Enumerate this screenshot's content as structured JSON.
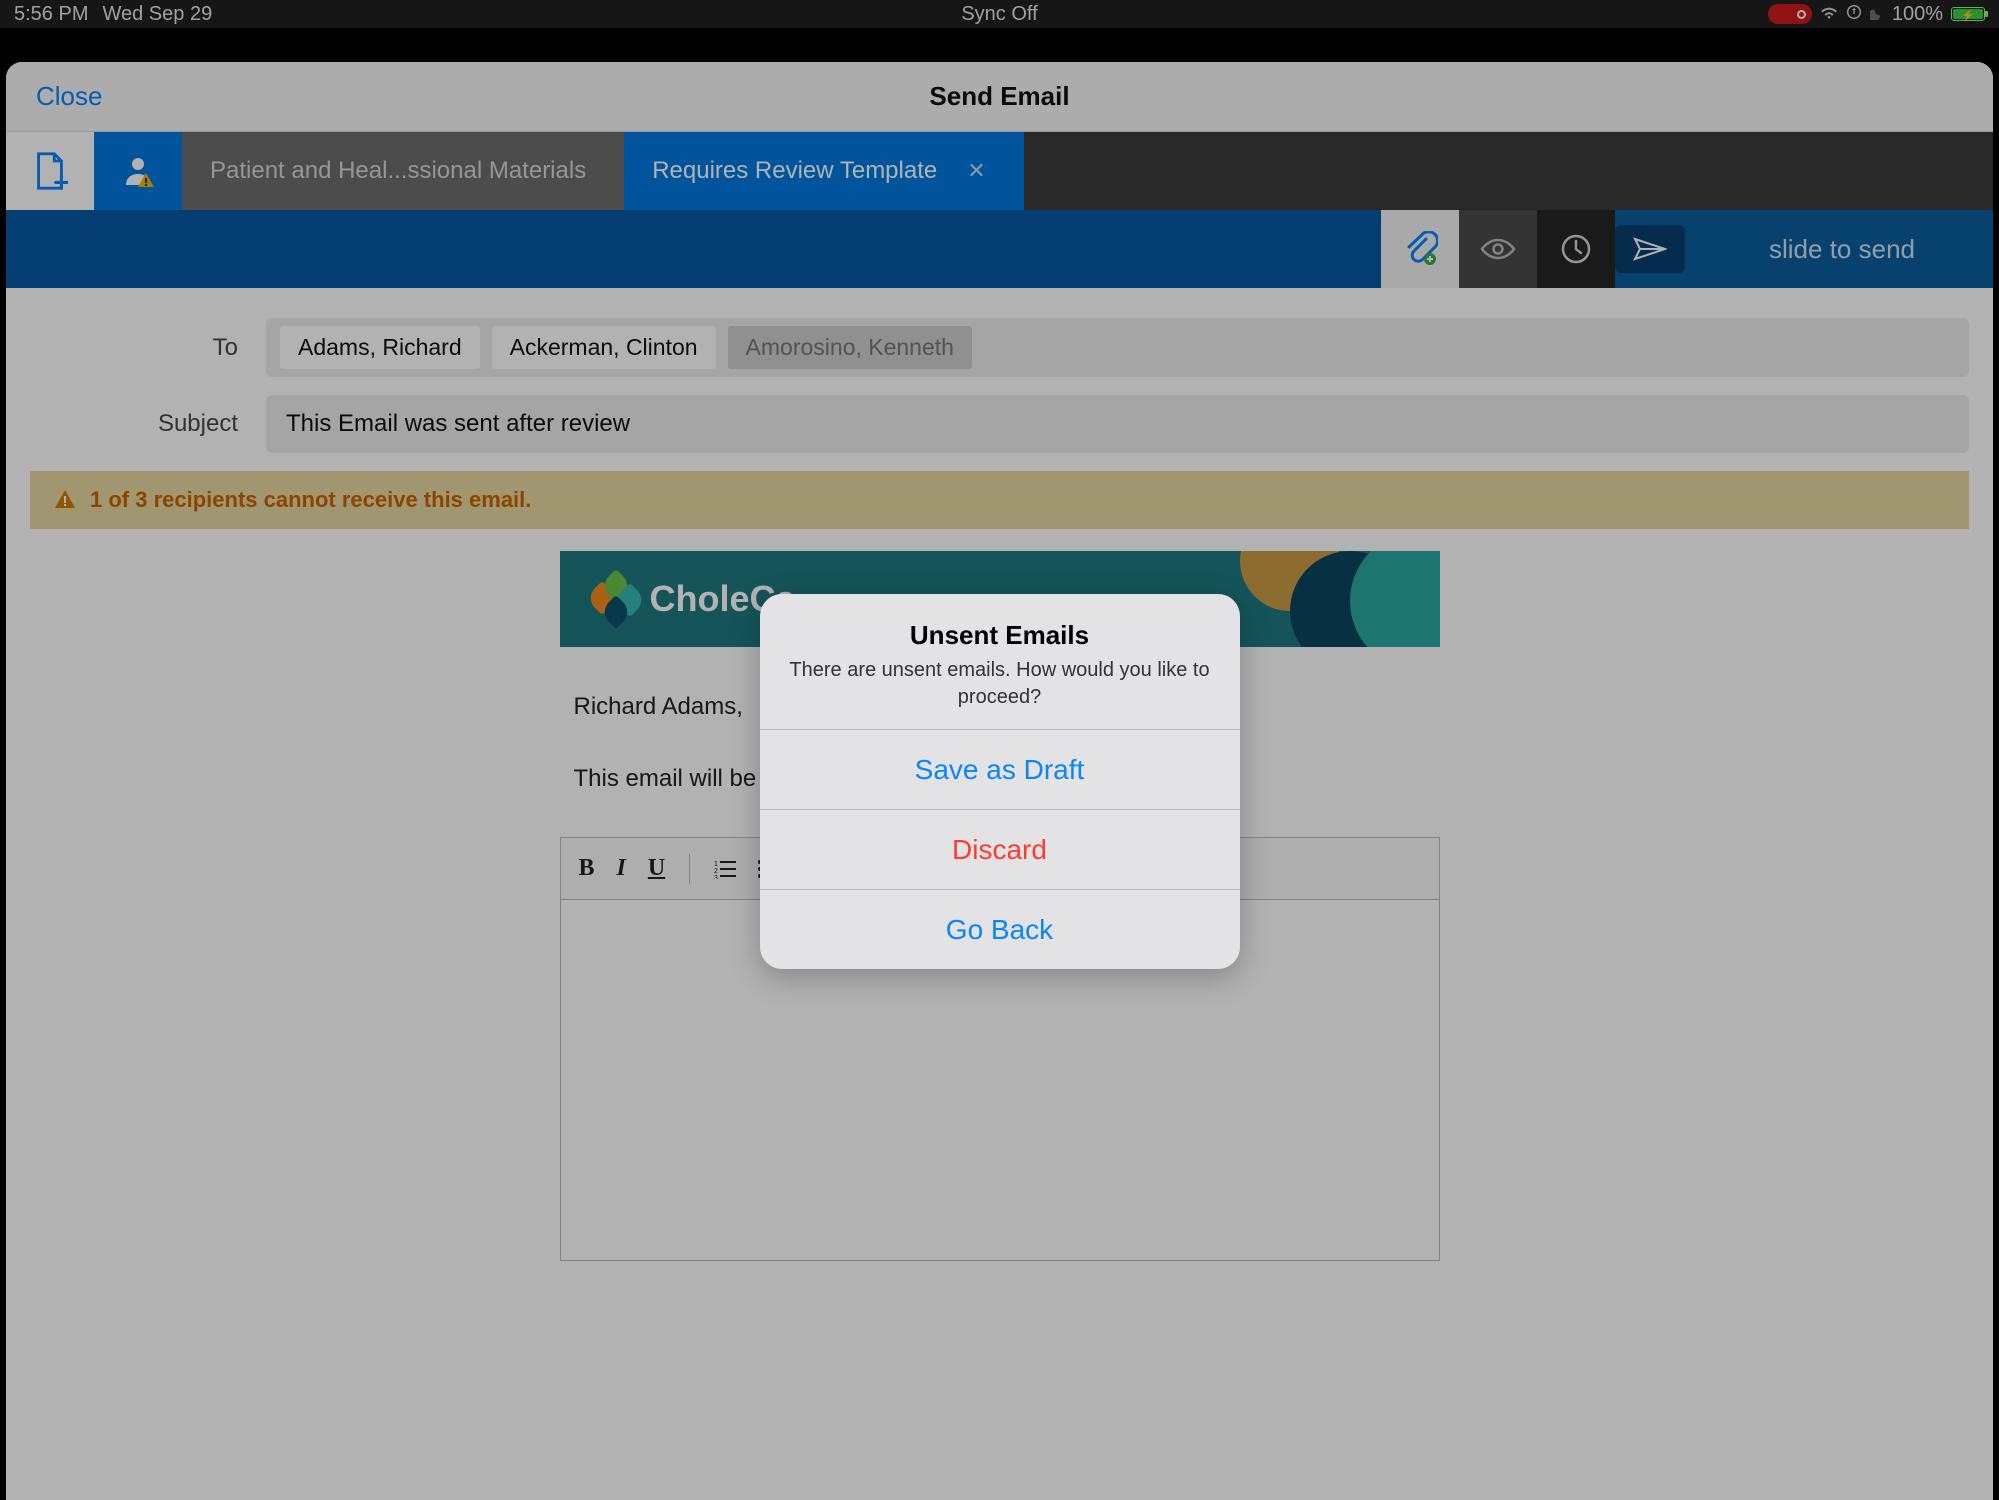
{
  "status": {
    "time": "5:56 PM",
    "date": "Wed Sep 29",
    "sync": "Sync Off",
    "battery": "100%"
  },
  "nav": {
    "close": "Close",
    "title": "Send Email"
  },
  "tabs": {
    "tab1": "Patient and Heal...ssional Materials",
    "tab2": "Requires Review Template"
  },
  "actionbar": {
    "slide_label": "slide to send"
  },
  "fields": {
    "to_label": "To",
    "recipients": {
      "r0": "Adams, Richard",
      "r1": "Ackerman, Clinton",
      "r2": "Amorosino, Kenneth"
    },
    "subject_label": "Subject",
    "subject_value": "This Email was sent after review"
  },
  "warning": "1 of 3 recipients cannot receive this email.",
  "banner": {
    "brand": "CholeCa"
  },
  "body": {
    "greeting": "Richard Adams,",
    "line1": "This email will be revie"
  },
  "modal": {
    "title": "Unsent Emails",
    "message": "There are unsent emails. How would you like to proceed?",
    "save": "Save as Draft",
    "discard": "Discard",
    "goback": "Go Back"
  }
}
